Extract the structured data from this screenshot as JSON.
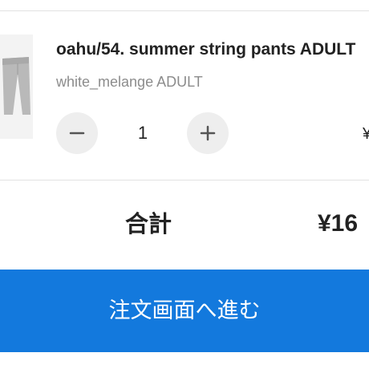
{
  "cart_item": {
    "title": "oahu/54. summer string pants ADULT",
    "variant": "white_melange ADULT",
    "quantity": "1",
    "line_price": "¥",
    "minus_icon": "minus-icon",
    "plus_icon": "plus-icon"
  },
  "summary": {
    "total_label": "合計",
    "total_value": "¥16"
  },
  "checkout": {
    "label": "注文画面へ進む",
    "color": "#1379dd"
  }
}
